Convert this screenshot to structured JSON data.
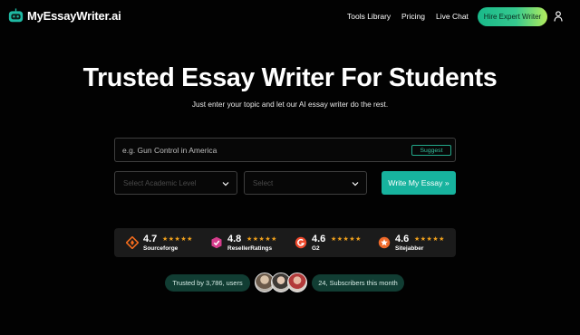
{
  "nav": {
    "logo_text": "MyEssayWriter.ai",
    "links": [
      "Tools Library",
      "Pricing",
      "Live Chat"
    ],
    "cta_label": "Hire Expert Writer"
  },
  "hero": {
    "title": "Trusted Essay Writer For Students",
    "subtitle": "Just enter your topic and let our AI essay writer do the rest."
  },
  "form": {
    "topic_placeholder": "e.g. Gun Control in America",
    "suggest_label": "Suggest",
    "select1_value": "Select Academic Level",
    "select2_value": "Select",
    "submit_label": "Write My Essay »"
  },
  "ratings": [
    {
      "score": "4.7",
      "name": "Sourceforge",
      "stars": "★★★★★",
      "icon": "sourceforge-icon",
      "color": "#f26b1d"
    },
    {
      "score": "4.8",
      "name": "ResellerRatings",
      "stars": "★★★★★",
      "icon": "resellerratings-icon",
      "color": "#d63c8c"
    },
    {
      "score": "4.6",
      "name": "G2",
      "stars": "★★★★★",
      "icon": "g2-icon",
      "color": "#ef4a2d"
    },
    {
      "score": "4.6",
      "name": "Sitejabber",
      "stars": "★★★★★",
      "icon": "sitejabber-icon",
      "color": "#f06a2a"
    }
  ],
  "trust": {
    "users_label": "Trusted by 3,786, users",
    "subscribers_label": "24, Subscribers this month"
  },
  "colors": {
    "accent": "#17b39e",
    "star": "#f2a21c",
    "pill_bg": "#113d33"
  }
}
